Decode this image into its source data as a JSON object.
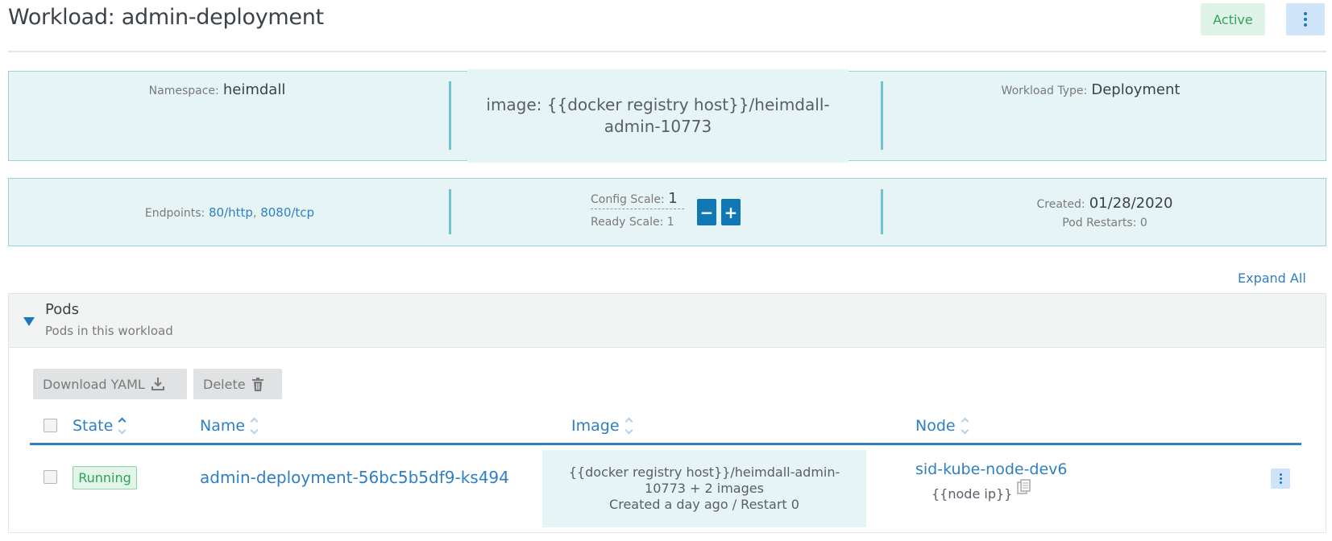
{
  "header": {
    "title": "Workload: admin-deployment",
    "state": "Active"
  },
  "summary": {
    "namespace_label": "Namespace:",
    "namespace_value": "heimdall",
    "image_text": "image: {{docker registry host}}/heimdall-admin-10773",
    "workload_type_label": "Workload Type:",
    "workload_type_value": "Deployment",
    "endpoints_label": "Endpoints:",
    "endpoints": [
      "80/http",
      "8080/tcp"
    ],
    "config_scale_label": "Config Scale:",
    "config_scale_value": "1",
    "ready_scale_text": "Ready Scale: 1",
    "created_label": "Created:",
    "created_value": "01/28/2020",
    "pod_restarts_text": "Pod Restarts: 0"
  },
  "expand_all": "Expand All",
  "pods_section": {
    "title": "Pods",
    "subtitle": "Pods in this workload",
    "download_yaml": "Download YAML",
    "delete": "Delete",
    "columns": [
      "State",
      "Name",
      "Image",
      "Node"
    ],
    "rows": [
      {
        "state": "Running",
        "name": "admin-deployment-56bc5b5df9-ks494",
        "image_line1": "{{docker registry host}}/heimdall-admin-10773 + 2 images",
        "image_line2": "Created a day ago / Restart 0",
        "node": "sid-kube-node-dev6",
        "node_ip": "{{node ip}}"
      }
    ]
  },
  "colors": {
    "accent": "#2f7fc4",
    "info_bg": "#e7f4f6",
    "info_border": "#9fd3dc",
    "success": "#2fa357",
    "scale_button": "#1277b5"
  }
}
